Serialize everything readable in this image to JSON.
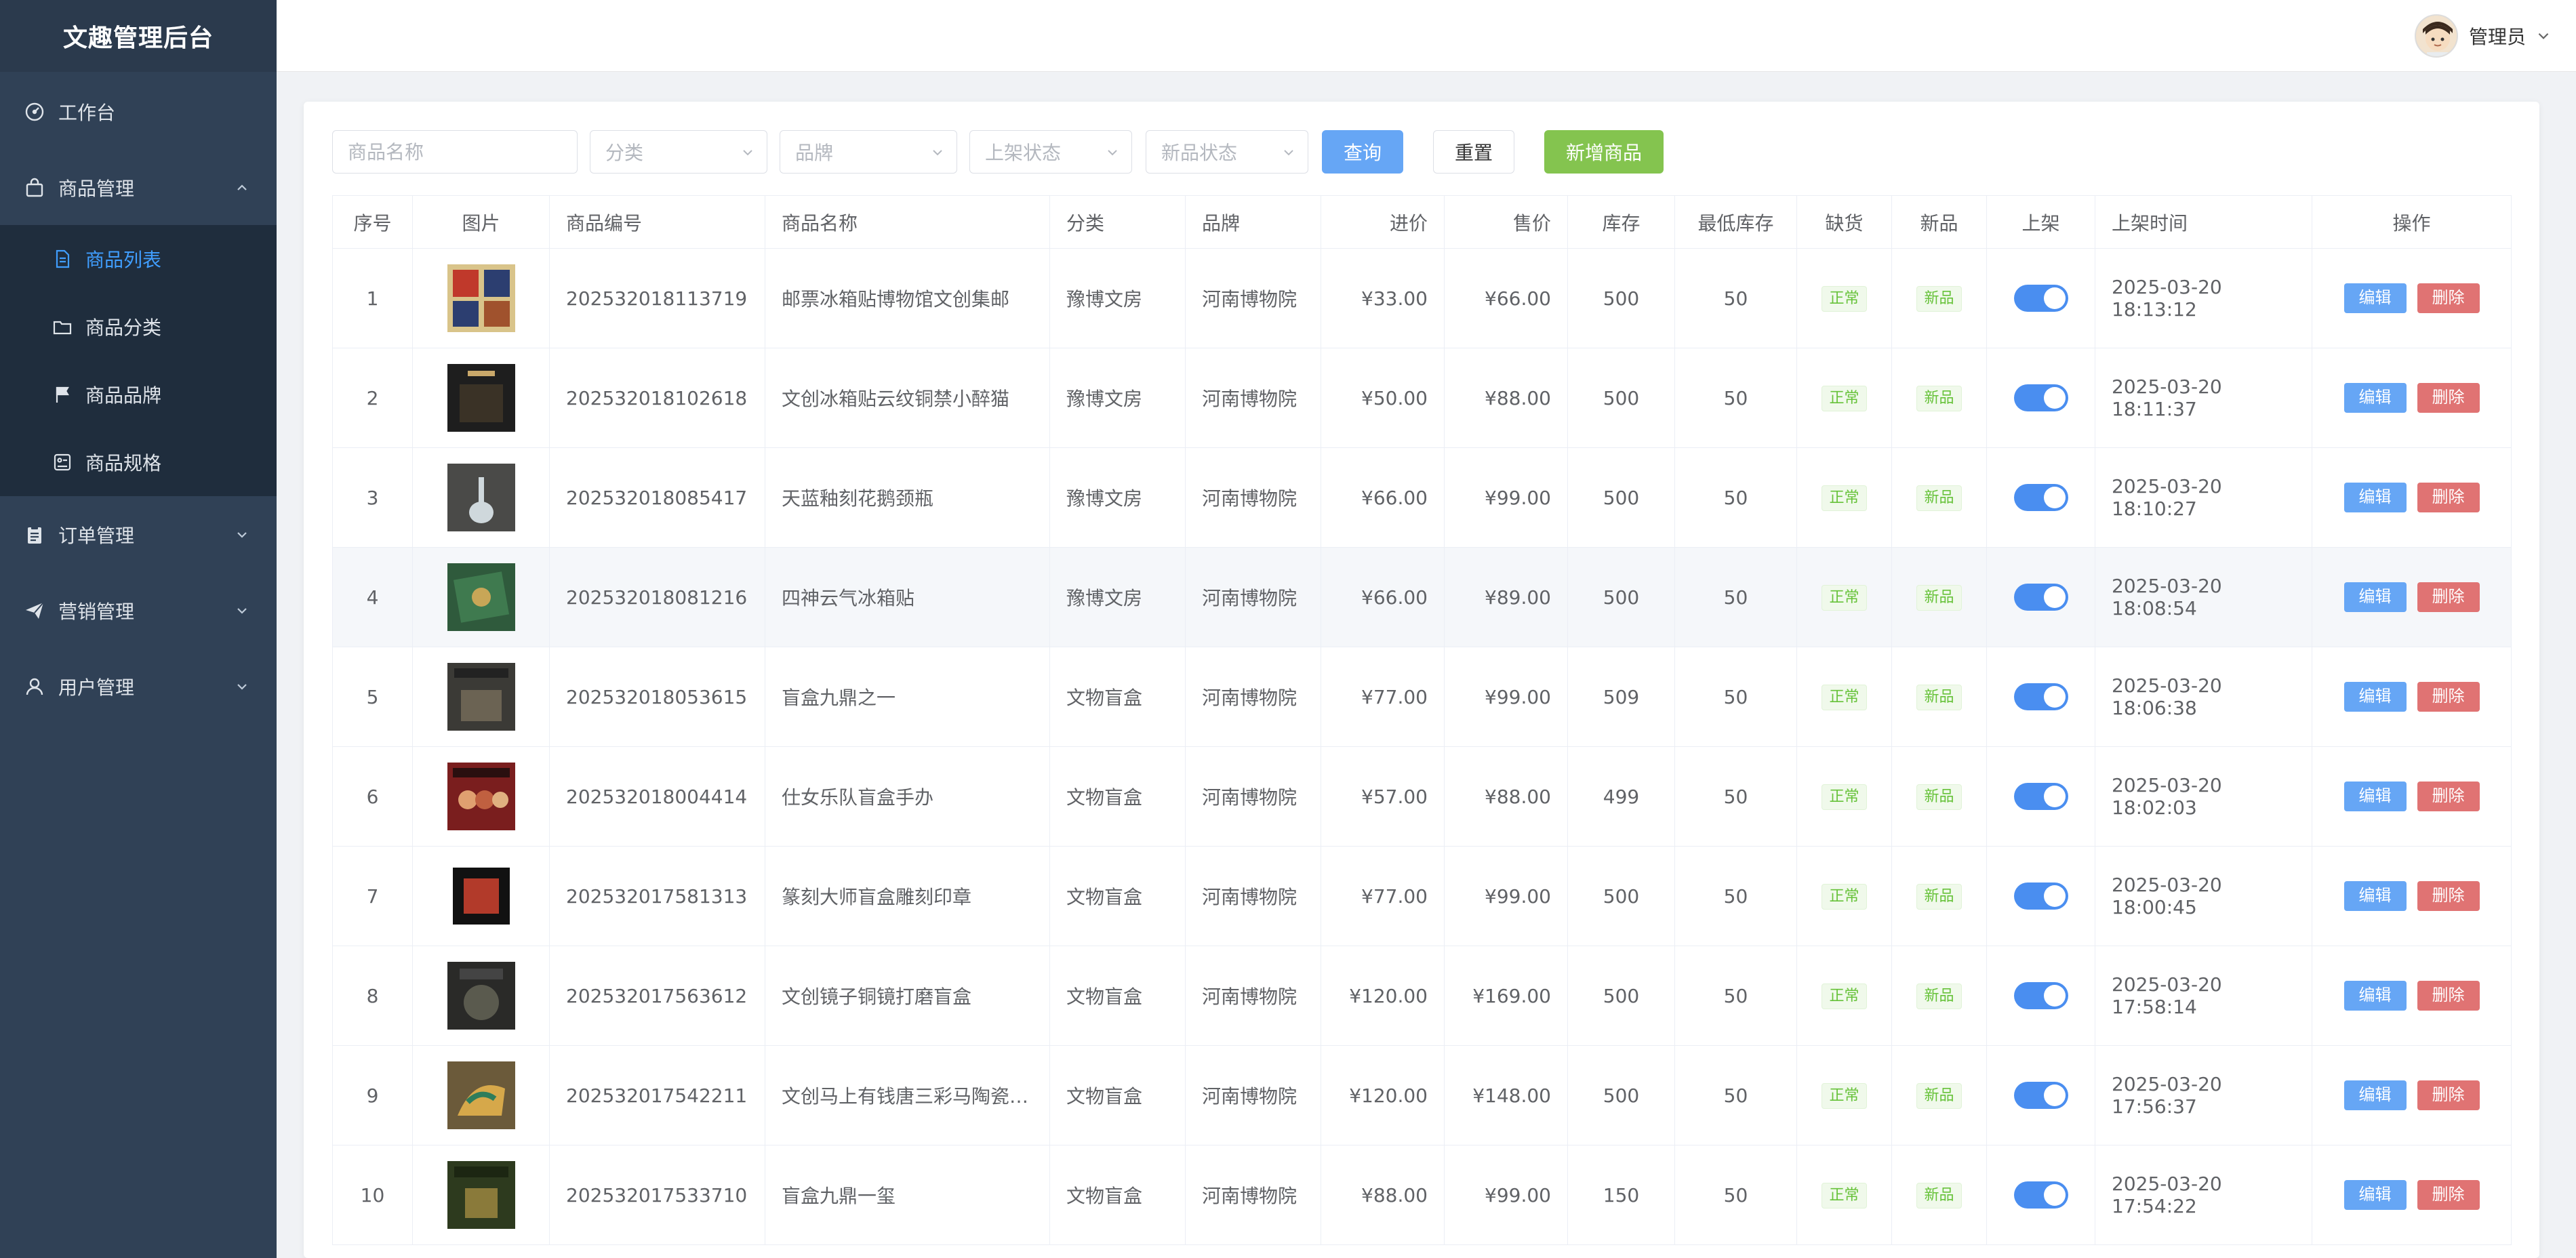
{
  "app": {
    "title": "文趣管理后台"
  },
  "sidebar": {
    "dashboard": "工作台",
    "goods": "商品管理",
    "goods_list": "商品列表",
    "goods_category": "商品分类",
    "goods_brand": "商品品牌",
    "goods_spec": "商品规格",
    "orders": "订单管理",
    "marketing": "营销管理",
    "users": "用户管理"
  },
  "header": {
    "user_name": "管理员"
  },
  "filters": {
    "name_placeholder": "商品名称",
    "category_placeholder": "分类",
    "brand_placeholder": "品牌",
    "shelf_placeholder": "上架状态",
    "new_placeholder": "新品状态",
    "query": "查询",
    "reset": "重置",
    "add": "新增商品"
  },
  "table": {
    "headers": [
      "序号",
      "图片",
      "商品编号",
      "商品名称",
      "分类",
      "品牌",
      "进价",
      "售价",
      "库存",
      "最低库存",
      "缺货",
      "新品",
      "上架",
      "上架时间",
      "操作"
    ],
    "edit_label": "编辑",
    "delete_label": "删除",
    "rows": [
      {
        "idx": "1",
        "code": "202532018113719",
        "name": "邮票冰箱贴博物馆文创集邮",
        "cat": "豫博文房",
        "brand": "河南博物院",
        "cost": "¥33.00",
        "price": "¥66.00",
        "stock": "500",
        "min": "50",
        "lack": "正常",
        "new": "新品",
        "on": true,
        "time": "2025-03-20 18:13:12"
      },
      {
        "idx": "2",
        "code": "202532018102618",
        "name": "文创冰箱贴云纹铜禁小醉猫",
        "cat": "豫博文房",
        "brand": "河南博物院",
        "cost": "¥50.00",
        "price": "¥88.00",
        "stock": "500",
        "min": "50",
        "lack": "正常",
        "new": "新品",
        "on": true,
        "time": "2025-03-20 18:11:37"
      },
      {
        "idx": "3",
        "code": "202532018085417",
        "name": "天蓝釉刻花鹅颈瓶",
        "cat": "豫博文房",
        "brand": "河南博物院",
        "cost": "¥66.00",
        "price": "¥99.00",
        "stock": "500",
        "min": "50",
        "lack": "正常",
        "new": "新品",
        "on": true,
        "time": "2025-03-20 18:10:27"
      },
      {
        "idx": "4",
        "code": "202532018081216",
        "name": "四神云气冰箱贴",
        "cat": "豫博文房",
        "brand": "河南博物院",
        "cost": "¥66.00",
        "price": "¥89.00",
        "stock": "500",
        "min": "50",
        "lack": "正常",
        "new": "新品",
        "on": true,
        "time": "2025-03-20 18:08:54"
      },
      {
        "idx": "5",
        "code": "202532018053615",
        "name": "盲盒九鼎之一",
        "cat": "文物盲盒",
        "brand": "河南博物院",
        "cost": "¥77.00",
        "price": "¥99.00",
        "stock": "509",
        "min": "50",
        "lack": "正常",
        "new": "新品",
        "on": true,
        "time": "2025-03-20 18:06:38"
      },
      {
        "idx": "6",
        "code": "202532018004414",
        "name": "仕女乐队盲盒手办",
        "cat": "文物盲盒",
        "brand": "河南博物院",
        "cost": "¥57.00",
        "price": "¥88.00",
        "stock": "499",
        "min": "50",
        "lack": "正常",
        "new": "新品",
        "on": true,
        "time": "2025-03-20 18:02:03"
      },
      {
        "idx": "7",
        "code": "202532017581313",
        "name": "篆刻大师盲盒雕刻印章",
        "cat": "文物盲盒",
        "brand": "河南博物院",
        "cost": "¥77.00",
        "price": "¥99.00",
        "stock": "500",
        "min": "50",
        "lack": "正常",
        "new": "新品",
        "on": true,
        "time": "2025-03-20 18:00:45"
      },
      {
        "idx": "8",
        "code": "202532017563612",
        "name": "文创镜子铜镜打磨盲盒",
        "cat": "文物盲盒",
        "brand": "河南博物院",
        "cost": "¥120.00",
        "price": "¥169.00",
        "stock": "500",
        "min": "50",
        "lack": "正常",
        "new": "新品",
        "on": true,
        "time": "2025-03-20 17:58:14"
      },
      {
        "idx": "9",
        "code": "202532017542211",
        "name": "文创马上有钱唐三彩马陶瓷…",
        "cat": "文物盲盒",
        "brand": "河南博物院",
        "cost": "¥120.00",
        "price": "¥148.00",
        "stock": "500",
        "min": "50",
        "lack": "正常",
        "new": "新品",
        "on": true,
        "time": "2025-03-20 17:56:37"
      },
      {
        "idx": "10",
        "code": "202532017533710",
        "name": "盲盒九鼎一玺",
        "cat": "文物盲盒",
        "brand": "河南博物院",
        "cost": "¥88.00",
        "price": "¥99.00",
        "stock": "150",
        "min": "50",
        "lack": "正常",
        "new": "新品",
        "on": true,
        "time": "2025-03-20 17:54:22"
      }
    ]
  },
  "colors": {
    "sidebar_bg": "#304156",
    "active": "#409eff",
    "primary": "#66a6f5",
    "success": "#84c44f",
    "danger": "#e07373",
    "switch_on": "#4a8ef0"
  }
}
